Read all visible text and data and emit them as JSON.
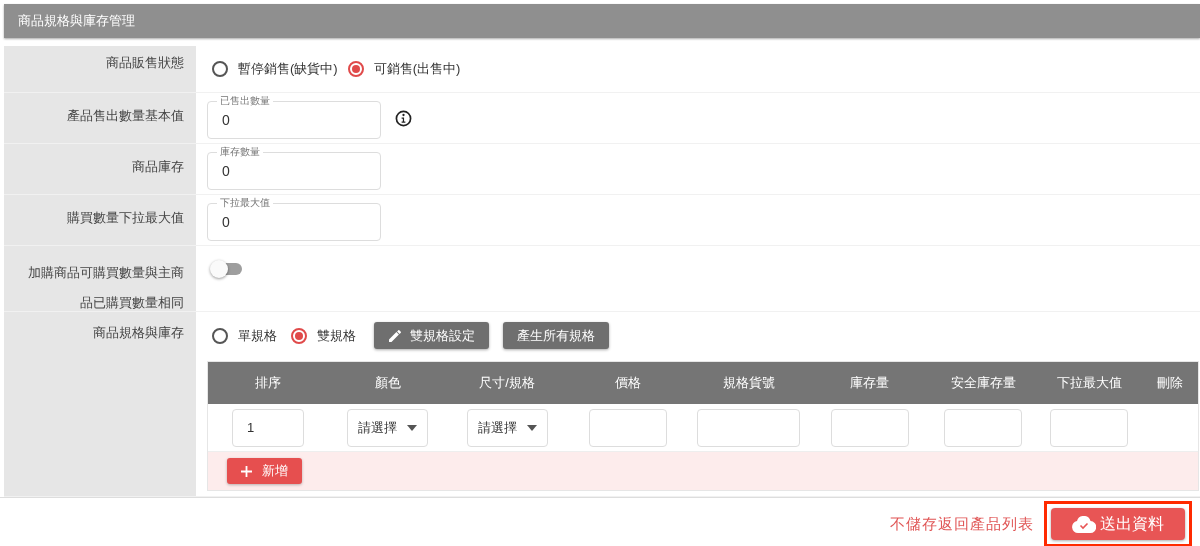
{
  "section_title": "商品規格與庫存管理",
  "rows": [
    {
      "kind": "radio",
      "label": "商品販售狀態",
      "options": [
        {
          "label": "暫停銷售(缺貨中)",
          "selected": false
        },
        {
          "label": "可銷售(出售中)",
          "selected": true
        }
      ]
    },
    {
      "kind": "field",
      "label": "產品售出數量基本值",
      "field": {
        "floating_label": "已售出數量",
        "value": "0"
      },
      "info": true
    },
    {
      "kind": "field",
      "label": "商品庫存",
      "field": {
        "floating_label": "庫存數量",
        "value": "0"
      },
      "info": false
    },
    {
      "kind": "field",
      "label": "購買數量下拉最大值",
      "field": {
        "floating_label": "下拉最大值",
        "value": "0"
      },
      "info": false
    },
    {
      "kind": "toggle",
      "label": "加購商品可購買數量與主商品已購買數量相同",
      "on": false
    },
    {
      "kind": "spec",
      "label": "商品規格與庫存",
      "options": [
        {
          "label": "單規格",
          "selected": false
        },
        {
          "label": "雙規格",
          "selected": true
        }
      ],
      "buttons": [
        {
          "label": "雙規格設定",
          "kind": "edit"
        },
        {
          "label": "產生所有規格",
          "kind": "plain"
        }
      ],
      "table": {
        "columns": [
          "排序",
          "顏色",
          "尺寸/規格",
          "價格",
          "規格貨號",
          "庫存量",
          "安全庫存量",
          "下拉最大值",
          "刪除"
        ],
        "rows": [
          {
            "cells": [
              {
                "kind": "input",
                "value": "1"
              },
              {
                "kind": "select",
                "value": "請選擇"
              },
              {
                "kind": "select",
                "value": "請選擇"
              },
              {
                "kind": "input"
              },
              {
                "kind": "input"
              },
              {
                "kind": "input"
              },
              {
                "kind": "input"
              },
              {
                "kind": "input"
              },
              {
                "kind": "empty"
              }
            ]
          }
        ],
        "add_button": "新增"
      }
    }
  ],
  "footer": {
    "cancel_link": "不儲存返回產品列表",
    "submit_button": "送出資料",
    "submit_highlighted": true
  }
}
